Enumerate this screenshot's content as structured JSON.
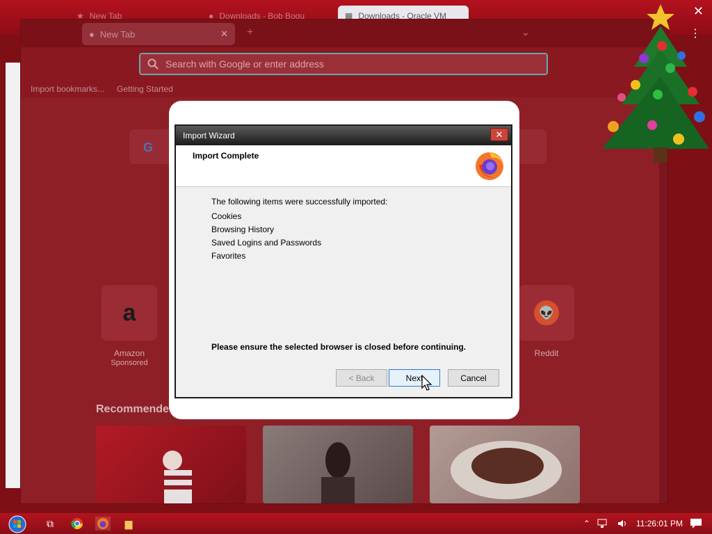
{
  "host": {
    "tabs": [
      {
        "label": "New Tab"
      },
      {
        "label": "Downloads - Bob Bogu"
      },
      {
        "label": "Downloads - Oracle VM"
      }
    ],
    "close_glyph": "✕",
    "menu_glyph": "⋮"
  },
  "firefox": {
    "tab_label": "New Tab",
    "tab_close": "✕",
    "new_tab_glyph": "+",
    "list_tabs_glyph": "⌄",
    "url_placeholder": "Search with Google or enter address",
    "bookmarks": [
      "Import bookmarks...",
      "Getting Started"
    ],
    "google_letter": "G",
    "tiles": [
      {
        "icon": "a",
        "label": "Amazon",
        "sublabel": "Sponsored"
      },
      {
        "icon": "👽",
        "label": "Reddit",
        "sublabel": ""
      }
    ],
    "recommended_title": "Recommende",
    "card_colors": [
      "#a11622",
      "#6f5a5a",
      "#8a6a66"
    ]
  },
  "dialog": {
    "title": "Import Wizard",
    "close_glyph": "✕",
    "heading": "Import Complete",
    "message": "The following items were successfully imported:",
    "items": [
      "Cookies",
      "Browsing History",
      "Saved Logins and Passwords",
      "Favorites"
    ],
    "warning": "Please ensure the selected browser is closed before continuing.",
    "buttons": {
      "back": "< Back",
      "next": "Next",
      "cancel": "Cancel"
    }
  },
  "taskbar": {
    "clock": "11:26:01 PM",
    "tray_up": "⌃",
    "task_view_glyph": "⧉",
    "folder_glyph": "▆"
  },
  "colors": {
    "accent": "#b3121e",
    "dialog_title": "#2a2a2a",
    "default_button_border": "#2f7ad6"
  }
}
